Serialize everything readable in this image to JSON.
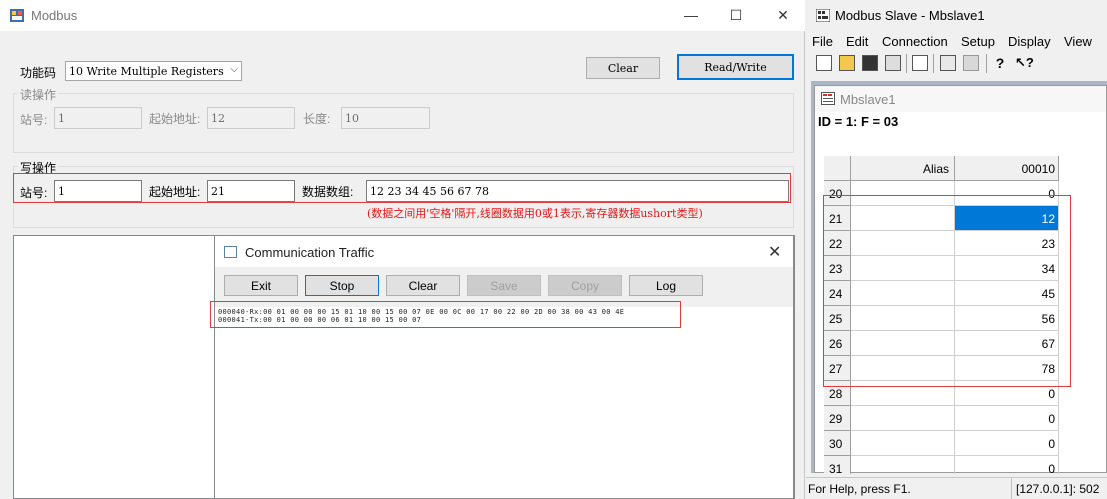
{
  "left_window": {
    "title": "Modbus",
    "function_label": "功能码",
    "function_value": "10 Write Multiple Registers",
    "clear_label": "Clear",
    "readwrite_label": "Read/Write",
    "read_group": {
      "title": "读操作",
      "station_label": "站号:",
      "station_value": "1",
      "start_label": "起始地址:",
      "start_value": "12",
      "length_label": "长度:",
      "length_value": "10"
    },
    "write_group": {
      "title": "写操作",
      "station_label": "站号:",
      "station_value": "1",
      "start_label": "起始地址:",
      "start_value": "21",
      "data_label": "数据数组:",
      "data_value": "12 23 34 45 56 67 78",
      "hint": "(数据之间用'空格'隔开,线圈数据用0或1表示,寄存器数据ushort类型)"
    }
  },
  "traffic_window": {
    "title": "Communication Traffic",
    "buttons": [
      "Exit",
      "Stop",
      "Clear",
      "Save",
      "Copy",
      "Log"
    ],
    "log_lines": [
      "000040-Rx:00 01 00 00 00 15 01 10 00 15 00 07 0E 00 0C 00 17 00 22 00 2D 00 38 00 43 00 4E",
      "000041-Tx:00 01 00 00 00 06 01 10 00 15 00 07"
    ]
  },
  "right_window": {
    "title": "Modbus Slave - Mbslave1",
    "menus": [
      "File",
      "Edit",
      "Connection",
      "Setup",
      "Display",
      "View"
    ],
    "child_title": "Mbslave1",
    "id_line": "ID = 1: F = 03",
    "grid": {
      "alias_header": "Alias",
      "col_header": "00010",
      "rows": [
        {
          "addr": "20",
          "value": "0"
        },
        {
          "addr": "21",
          "value": "12"
        },
        {
          "addr": "22",
          "value": "23"
        },
        {
          "addr": "23",
          "value": "34"
        },
        {
          "addr": "24",
          "value": "45"
        },
        {
          "addr": "25",
          "value": "56"
        },
        {
          "addr": "26",
          "value": "67"
        },
        {
          "addr": "27",
          "value": "78"
        },
        {
          "addr": "28",
          "value": "0"
        },
        {
          "addr": "29",
          "value": "0"
        },
        {
          "addr": "30",
          "value": "0"
        },
        {
          "addr": "31",
          "value": "0"
        }
      ]
    },
    "status_left": "For Help, press F1.",
    "status_right": "[127.0.0.1]: 502"
  },
  "colors": {
    "highlight_box": "#e03c3c",
    "selection": "#0078d7",
    "hint_text": "#e01818"
  }
}
